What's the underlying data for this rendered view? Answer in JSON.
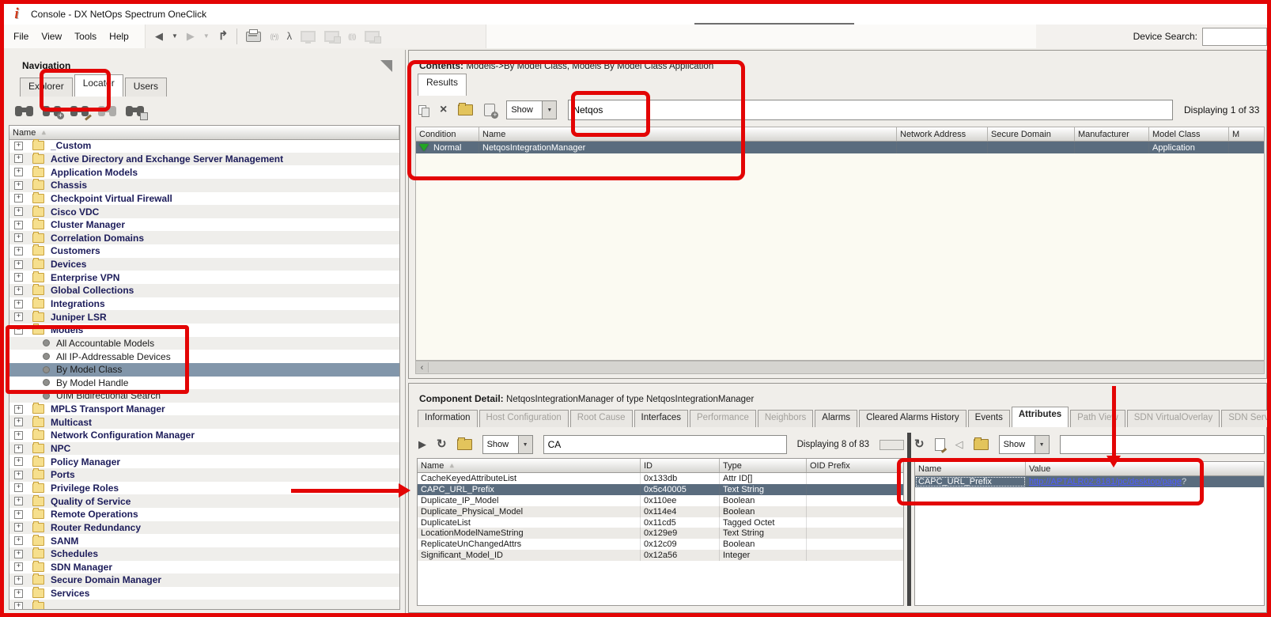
{
  "window": {
    "title": "Console - DX NetOps Spectrum OneClick",
    "logo_glyph": "i"
  },
  "menu": [
    "File",
    "View",
    "Tools",
    "Help"
  ],
  "main_toolbar": [
    {
      "name": "back-arrow-icon",
      "type": "tri-left",
      "enabled": true
    },
    {
      "name": "back-history-icon",
      "type": "caret-down",
      "enabled": true
    },
    {
      "name": "forward-arrow-icon",
      "type": "tri-right",
      "enabled": false
    },
    {
      "name": "forward-history-icon",
      "type": "caret-down",
      "enabled": false
    },
    {
      "name": "go-up-icon",
      "type": "up-arrow",
      "enabled": true
    },
    {
      "name": "toolbar-separator",
      "type": "sep",
      "enabled": true
    },
    {
      "name": "print-icon",
      "type": "printer",
      "enabled": true
    },
    {
      "name": "broadcast-icon",
      "type": "broadcast",
      "enabled": false
    },
    {
      "name": "topology-icon",
      "type": "person",
      "enabled": true
    },
    {
      "name": "monitor-icon",
      "type": "monitor",
      "enabled": false
    },
    {
      "name": "locked-monitor-icon",
      "type": "monitor-badge",
      "enabled": false
    },
    {
      "name": "antenna-icon",
      "type": "antenna",
      "enabled": false
    },
    {
      "name": "globe-monitor-icon",
      "type": "monitor-badge2",
      "enabled": false
    }
  ],
  "device_search": {
    "label": "Device Search:",
    "value": ""
  },
  "navigation": {
    "title": "Navigation",
    "tabs": [
      {
        "label": "Explorer",
        "active": false
      },
      {
        "label": "Locater",
        "active": true
      },
      {
        "label": "Users",
        "active": false
      }
    ],
    "search_toolbar": [
      {
        "name": "search-icon",
        "badge": "",
        "disabled": false
      },
      {
        "name": "create-search-icon",
        "badge": "plus",
        "disabled": false
      },
      {
        "name": "edit-search-icon",
        "badge": "pencil",
        "disabled": false
      },
      {
        "name": "search-all-icon",
        "badge": "",
        "disabled": true
      },
      {
        "name": "copy-search-icon",
        "badge": "square",
        "disabled": false
      }
    ],
    "column_header": "Name",
    "tree": [
      {
        "label": "_Custom",
        "kind": "folder"
      },
      {
        "label": "Active Directory and Exchange Server Management",
        "kind": "folder"
      },
      {
        "label": "Application Models",
        "kind": "folder"
      },
      {
        "label": "Chassis",
        "kind": "folder"
      },
      {
        "label": "Checkpoint Virtual Firewall",
        "kind": "folder"
      },
      {
        "label": "Cisco VDC",
        "kind": "folder"
      },
      {
        "label": "Cluster Manager",
        "kind": "folder"
      },
      {
        "label": "Correlation Domains",
        "kind": "folder"
      },
      {
        "label": "Customers",
        "kind": "folder"
      },
      {
        "label": "Devices",
        "kind": "folder"
      },
      {
        "label": "Enterprise VPN",
        "kind": "folder"
      },
      {
        "label": "Global Collections",
        "kind": "folder"
      },
      {
        "label": "Integrations",
        "kind": "folder"
      },
      {
        "label": "Juniper LSR",
        "kind": "folder"
      },
      {
        "label": "Models",
        "kind": "folder",
        "expanded": true
      },
      {
        "label": "All Accountable Models",
        "kind": "child"
      },
      {
        "label": "All IP-Addressable Devices",
        "kind": "child"
      },
      {
        "label": "By Model Class",
        "kind": "child",
        "selected": true
      },
      {
        "label": "By Model Handle",
        "kind": "child"
      },
      {
        "label": "UIM Bidirectional Search",
        "kind": "child"
      },
      {
        "label": "MPLS Transport Manager",
        "kind": "folder"
      },
      {
        "label": "Multicast",
        "kind": "folder"
      },
      {
        "label": "Network Configuration Manager",
        "kind": "folder"
      },
      {
        "label": "NPC",
        "kind": "folder"
      },
      {
        "label": "Policy Manager",
        "kind": "folder"
      },
      {
        "label": "Ports",
        "kind": "folder"
      },
      {
        "label": "Privilege Roles",
        "kind": "folder"
      },
      {
        "label": "Quality of Service",
        "kind": "folder"
      },
      {
        "label": "Remote Operations",
        "kind": "folder"
      },
      {
        "label": "Router Redundancy",
        "kind": "folder"
      },
      {
        "label": "SANM",
        "kind": "folder"
      },
      {
        "label": "Schedules",
        "kind": "folder"
      },
      {
        "label": "SDN Manager",
        "kind": "folder"
      },
      {
        "label": "Secure Domain Manager",
        "kind": "folder"
      },
      {
        "label": "Services",
        "kind": "folder"
      },
      {
        "label": "",
        "kind": "folder"
      }
    ]
  },
  "contents": {
    "title": "Contents:",
    "path": "Models->By Model Class, Models By Model Class Application",
    "tabs": [
      {
        "label": "Results",
        "active": true
      }
    ],
    "toolbar": [
      {
        "name": "copy-icon",
        "type": "copy"
      },
      {
        "name": "delete-icon",
        "type": "close-x"
      },
      {
        "name": "export-icon",
        "type": "folder"
      },
      {
        "name": "paste-add-icon",
        "type": "clipboard-plus"
      }
    ],
    "show_dropdown": {
      "label": "Show"
    },
    "filter": {
      "value": "Netqos"
    },
    "displaying": "Displaying 1 of 33",
    "table": {
      "columns": [
        "Condition",
        "Name",
        "Network Address",
        "Secure Domain",
        "Manufacturer",
        "Model Class",
        "M"
      ],
      "rows": [
        {
          "cells": [
            "Normal",
            "NetqosIntegrationManager",
            "",
            "",
            "",
            "Application",
            ""
          ],
          "condition_color": "#23a523",
          "selected": true
        }
      ]
    }
  },
  "component_detail": {
    "title": "Component Detail:",
    "subject": "NetqosIntegrationManager of type NetqosIntegrationManager",
    "tabs": [
      {
        "label": "Information",
        "state": "normal"
      },
      {
        "label": "Host Configuration",
        "state": "disabled"
      },
      {
        "label": "Root Cause",
        "state": "disabled"
      },
      {
        "label": "Interfaces",
        "state": "normal"
      },
      {
        "label": "Performance",
        "state": "disabled"
      },
      {
        "label": "Neighbors",
        "state": "disabled"
      },
      {
        "label": "Alarms",
        "state": "normal"
      },
      {
        "label": "Cleared Alarms History",
        "state": "normal"
      },
      {
        "label": "Events",
        "state": "normal"
      },
      {
        "label": "Attributes",
        "state": "active"
      },
      {
        "label": "Path View",
        "state": "disabled"
      },
      {
        "label": "SDN VirtualOverlay",
        "state": "disabled"
      },
      {
        "label": "SDN ServiceView",
        "state": "disabled"
      }
    ],
    "attributes_pane": {
      "toolbar": [
        {
          "name": "run-icon",
          "type": "play"
        },
        {
          "name": "refresh-icon",
          "type": "refresh"
        },
        {
          "name": "export-icon",
          "type": "folder"
        }
      ],
      "show_dropdown": {
        "label": "Show"
      },
      "filter": {
        "value": "CA"
      },
      "displaying": "Displaying 8 of 83",
      "columns": [
        "Name",
        "ID",
        "Type",
        "OID Prefix"
      ],
      "rows": [
        {
          "cells": [
            "CacheKeyedAttributeList",
            "0x133db",
            "Attr ID[]",
            ""
          ]
        },
        {
          "cells": [
            "CAPC_URL_Prefix",
            "0x5c40005",
            "Text String",
            ""
          ],
          "selected": true
        },
        {
          "cells": [
            "Duplicate_IP_Model",
            "0x110ee",
            "Boolean",
            ""
          ]
        },
        {
          "cells": [
            "Duplicate_Physical_Model",
            "0x114e4",
            "Boolean",
            ""
          ]
        },
        {
          "cells": [
            "DuplicateList",
            "0x11cd5",
            "Tagged Octet",
            ""
          ]
        },
        {
          "cells": [
            "LocationModelNameString",
            "0x129e9",
            "Text String",
            ""
          ]
        },
        {
          "cells": [
            "ReplicateUnChangedAttrs",
            "0x12c09",
            "Boolean",
            ""
          ]
        },
        {
          "cells": [
            "Significant_Model_ID",
            "0x12a56",
            "Integer",
            ""
          ]
        }
      ]
    },
    "values_pane": {
      "toolbar": [
        {
          "name": "refresh-icon",
          "type": "refresh"
        },
        {
          "name": "edit-attribute-icon",
          "type": "doc"
        },
        {
          "name": "previous-icon",
          "type": "tri-left-hollow"
        },
        {
          "name": "export-icon",
          "type": "folder"
        }
      ],
      "show_dropdown": {
        "label": "Show"
      },
      "filter": {
        "value": ""
      },
      "columns": [
        "Name",
        "Value"
      ],
      "rows": [
        {
          "name": "CAPC_URL_Prefix",
          "link": "http://APTALR02:8181/pc/desktop/page",
          "suffix": "?",
          "selected": true
        }
      ]
    }
  }
}
